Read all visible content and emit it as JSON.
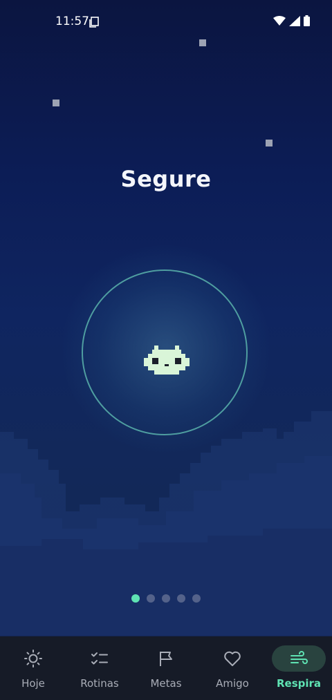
{
  "status_bar": {
    "time": "11:57"
  },
  "breathing": {
    "phase_label": "Segure"
  },
  "pager": {
    "total": 5,
    "active_index": 0
  },
  "nav": {
    "items": [
      {
        "label": "Hoje",
        "icon": "sun-icon",
        "active": false
      },
      {
        "label": "Rotinas",
        "icon": "checklist-icon",
        "active": false
      },
      {
        "label": "Metas",
        "icon": "flag-icon",
        "active": false
      },
      {
        "label": "Amigo",
        "icon": "heart-icon",
        "active": false
      },
      {
        "label": "Respira",
        "icon": "wind-icon",
        "active": true
      }
    ]
  },
  "colors": {
    "accent": "#5fe3b3",
    "ring": "#4f9ea0",
    "nav_bg": "#161b27"
  }
}
